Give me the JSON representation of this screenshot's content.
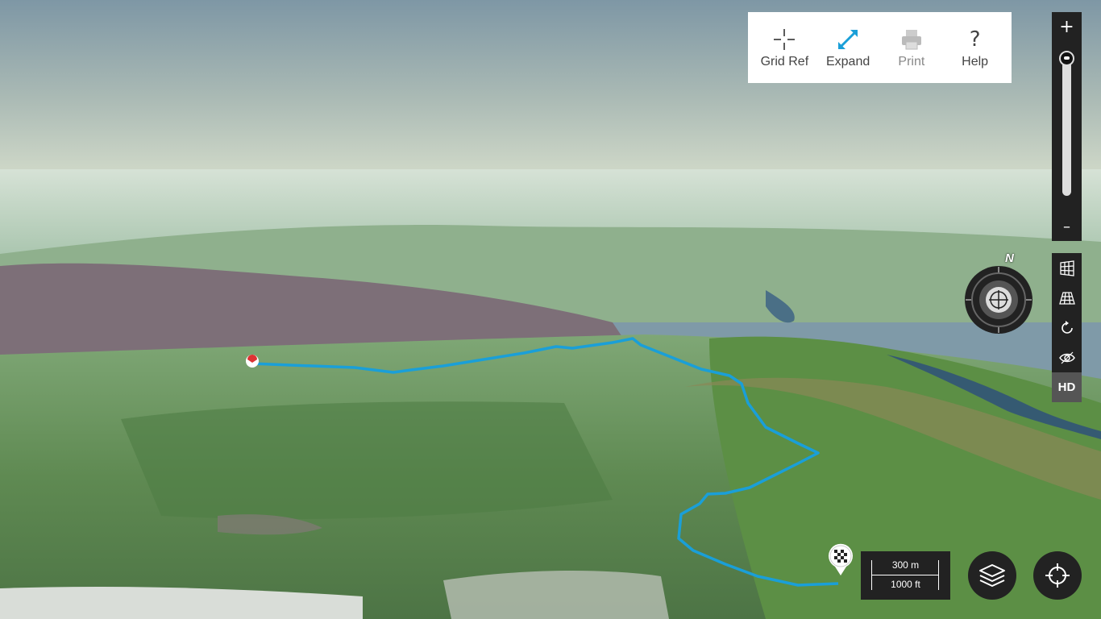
{
  "toolbar": {
    "grid_ref": "Grid Ref",
    "expand": "Expand",
    "print": "Print",
    "help": "Help"
  },
  "zoom": {
    "plus": "+",
    "minus": "–"
  },
  "compass": {
    "north": "N"
  },
  "tools": {
    "hd": "HD"
  },
  "scale": {
    "metric": "300 m",
    "imperial": "1000 ft"
  },
  "colors": {
    "route": "#1a9fd8",
    "accent": "#1a9fd8",
    "panel_dark": "#222222"
  },
  "icons": [
    "crosshair-icon",
    "expand-icon",
    "printer-icon",
    "help-icon",
    "map-grid-icon",
    "terrain-grid-icon",
    "rotate-icon",
    "eye-icon",
    "layers-icon",
    "locate-icon",
    "start-marker-icon",
    "finish-flag-icon"
  ]
}
